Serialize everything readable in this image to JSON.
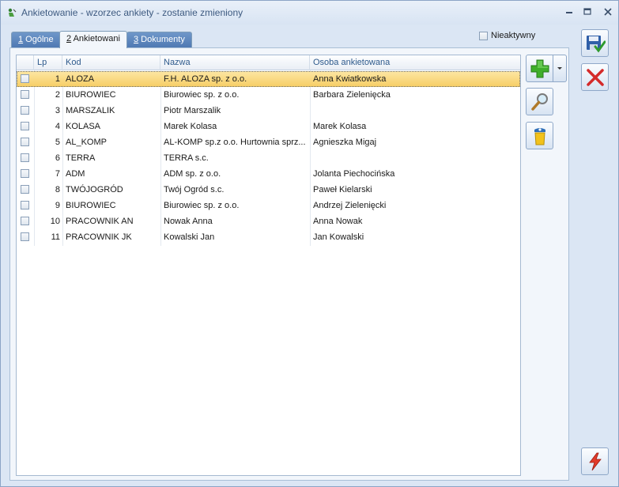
{
  "window": {
    "title": "Ankietowanie - wzorzec ankiety - zostanie zmieniony"
  },
  "tabs": [
    {
      "key": "1",
      "rest": " Ogólne",
      "active": false
    },
    {
      "key": "2",
      "rest": " Ankietowani",
      "active": true
    },
    {
      "key": "3",
      "rest": " Dokumenty",
      "active": false
    }
  ],
  "inactive_checkbox": {
    "label": "Nieaktywny",
    "checked": false
  },
  "grid": {
    "columns": {
      "lp": "Lp",
      "kod": "Kod",
      "nazwa": "Nazwa",
      "osoba": "Osoba ankietowana"
    },
    "selected_row": 0,
    "rows": [
      {
        "lp": "1",
        "kod": "ALOZA",
        "nazwa": "F.H. ALOZA sp. z o.o.",
        "osoba": "Anna Kwiatkowska"
      },
      {
        "lp": "2",
        "kod": "BIUROWIEC",
        "nazwa": "Biurowiec sp. z o.o.",
        "osoba": "Barbara Zielenięcka"
      },
      {
        "lp": "3",
        "kod": "MARSZALIK",
        "nazwa": "Piotr Marszalik",
        "osoba": ""
      },
      {
        "lp": "4",
        "kod": "KOLASA",
        "nazwa": "Marek Kolasa",
        "osoba": "Marek Kolasa"
      },
      {
        "lp": "5",
        "kod": "AL_KOMP",
        "nazwa": "AL-KOMP sp.z o.o. Hurtownia sprz...",
        "osoba": "Agnieszka Migaj"
      },
      {
        "lp": "6",
        "kod": "TERRA",
        "nazwa": "TERRA s.c.",
        "osoba": ""
      },
      {
        "lp": "7",
        "kod": "ADM",
        "nazwa": "ADM sp. z o.o.",
        "osoba": "Jolanta Piechocińska"
      },
      {
        "lp": "8",
        "kod": "TWÓJOGRÓD",
        "nazwa": "Twój Ogród s.c.",
        "osoba": "Paweł Kielarski"
      },
      {
        "lp": "9",
        "kod": "BIUROWIEC",
        "nazwa": "Biurowiec sp. z o.o.",
        "osoba": "Andrzej Zielenięcki"
      },
      {
        "lp": "10",
        "kod": "PRACOWNIK AN",
        "nazwa": "Nowak Anna",
        "osoba": "Anna Nowak"
      },
      {
        "lp": "11",
        "kod": "PRACOWNIK JK",
        "nazwa": "Kowalski Jan",
        "osoba": "Jan Kowalski"
      }
    ]
  },
  "toolbar_icons": {
    "add": "plus-icon",
    "view": "magnifier-icon",
    "delete": "trash-icon",
    "save": "save-icon",
    "cancel": "cancel-icon",
    "action": "lightning-icon"
  },
  "colors": {
    "selection": "#f6cd64",
    "tab_inactive": "#5a83bb",
    "header_text": "#2e5a8c",
    "add_green": "#3fae2a",
    "cancel_red": "#d42a2a"
  }
}
